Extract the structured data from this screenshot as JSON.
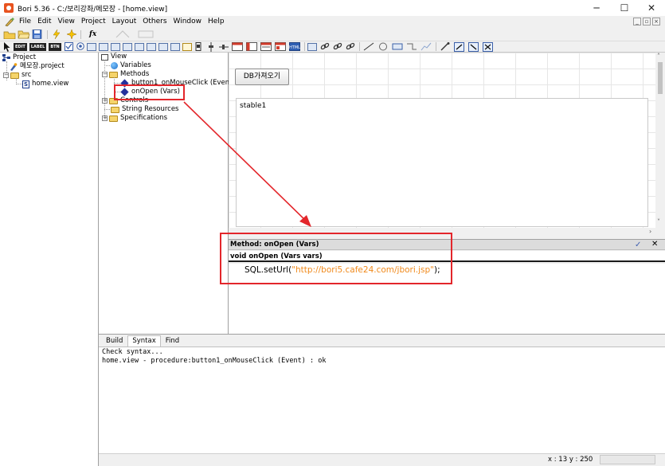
{
  "window": {
    "title": "Bori 5.36 - C:/보리강좌/메모장 - [home.view]",
    "min_glyph": "─",
    "max_glyph": "☐",
    "close_glyph": "✕"
  },
  "menu": [
    "File",
    "Edit",
    "View",
    "Project",
    "Layout",
    "Others",
    "Window",
    "Help"
  ],
  "toolbar": {
    "fx_label": "fx",
    "edit_btn": "EDIT",
    "label_btn": "LABEL",
    "btn_btn": "BTN"
  },
  "project_tree": {
    "root": "Project",
    "project_file": "메모장.project",
    "src_folder": "src",
    "view_file": "home.view"
  },
  "view_tree": {
    "root": "View",
    "variables": "Variables",
    "methods": "Methods",
    "method1": "button1_onMouseClick (Event)",
    "method2": "onOpen (Vars)",
    "controls": "Controls",
    "string_resources": "String Resources",
    "specifications": "Specifications"
  },
  "canvas": {
    "button_label": "DB가져오기",
    "table_label": "stable1"
  },
  "method_editor": {
    "header": "Method: onOpen (Vars)",
    "signature": "void onOpen (Vars vars)",
    "code_prefix": "SQL.setUrl(",
    "code_string": "\"http://bori5.cafe24.com/jbori.jsp\"",
    "code_suffix": ");"
  },
  "output": {
    "tabs": [
      "Build",
      "Syntax",
      "Find"
    ],
    "active_tab": "Syntax",
    "lines": [
      "Check syntax...",
      "home.view - procedure:button1_onMouseClick (Event) : ok"
    ]
  },
  "status": {
    "coords": "x : 13  y : 250"
  },
  "colors": {
    "annotation_red": "#e3262b",
    "string_literal": "#f08a1c"
  }
}
